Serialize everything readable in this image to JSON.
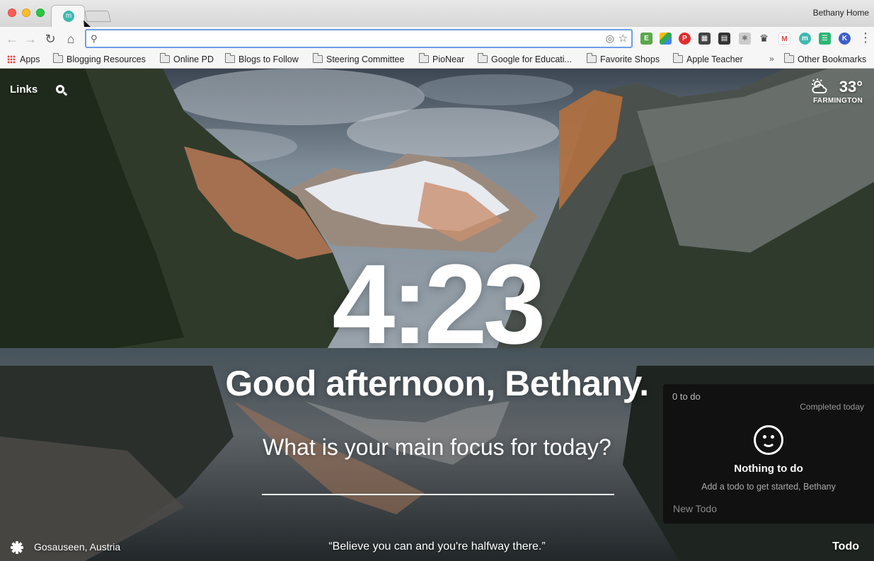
{
  "browser": {
    "profile_name": "Bethany Home",
    "tab_favicon_letter": "m",
    "omnibox_value": "",
    "bookmarks": {
      "apps": "Apps",
      "items": [
        "Blogging Resources",
        "Online PD",
        "Blogs to Follow",
        "Steering Committee",
        "PioNear",
        "Google for Educati...",
        "Favorite Shops",
        "Apple Teacher"
      ],
      "overflow": "»",
      "other": "Other Bookmarks"
    },
    "extensions": [
      "evernote",
      "drive",
      "pinterest",
      "qr",
      "film",
      "puzzle",
      "crown",
      "gmail",
      "momentum",
      "checklist",
      "k-extension"
    ]
  },
  "momentum": {
    "links_label": "Links",
    "weather": {
      "temp": "33°",
      "location": "FARMINGTON"
    },
    "clock": "4:23",
    "greeting": "Good afternoon, Bethany.",
    "focus_question": "What is your main focus for today?",
    "focus_value": "",
    "photo_location": "Gosauseen, Austria",
    "quote": "“Believe you can and you're halfway there.”",
    "todo_toggle": "Todo",
    "todo": {
      "count": "0 to do",
      "completed_label": "Completed today",
      "empty_title": "Nothing to do",
      "empty_subtitle": "Add a todo to get started, Bethany",
      "new_placeholder": "New Todo"
    }
  }
}
